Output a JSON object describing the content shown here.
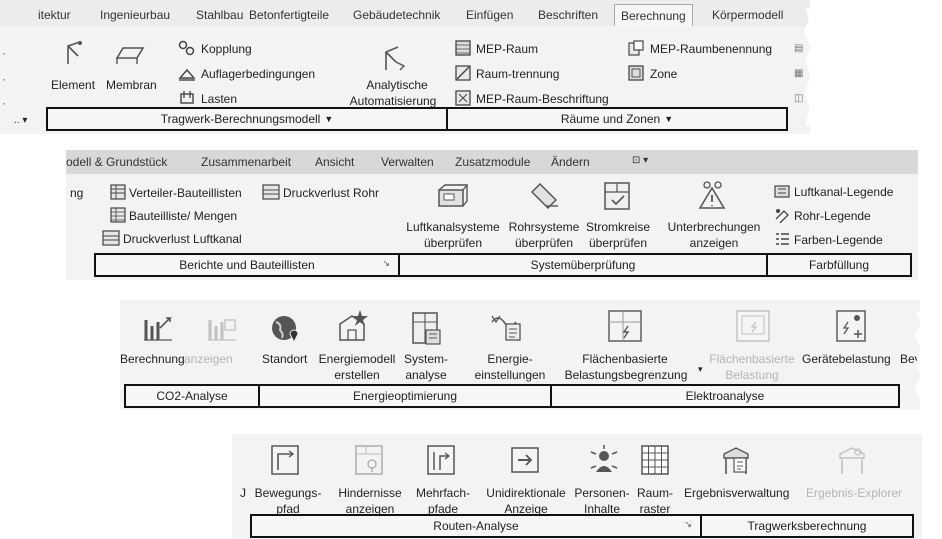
{
  "strip1": {
    "tabs": [
      "itektur",
      "Ingenieurbau",
      "Stahlbau",
      "Betonfertigteile",
      "Gebäudetechnik",
      "Einfügen",
      "Beschriften",
      "Berechnung",
      "Körpermodell"
    ],
    "active_tab": "Berechnung",
    "buttons": {
      "element": "Element",
      "membran": "Membran",
      "kopplung": "Kopplung",
      "auflager": "Auflagerbedingungen",
      "lasten": "Lasten",
      "analytische1": "Analytische",
      "analytische2": "Automatisierung",
      "mep_raum": "MEP-Raum",
      "raum_trennung": "Raum-trennung",
      "mep_raum_beschriftung": "MEP-Raum-Beschriftung",
      "mep_raumbenennung": "MEP-Raumbenennung",
      "zone": "Zone"
    },
    "panels": {
      "tragwerk": "Tragwerk-Berechnungsmodell",
      "raeume": "Räume und Zonen"
    }
  },
  "strip2": {
    "tabs": [
      "odell & Grundstück",
      "Zusammenarbeit",
      "Ansicht",
      "Verwalten",
      "Zusatzmodule",
      "Ändern"
    ],
    "buttons": {
      "ng": "ng",
      "verteiler": "Verteiler-Bauteillisten",
      "druckverlust_rohr": "Druckverlust Rohr",
      "bauteilliste": "Bauteilliste/ Mengen",
      "druckverlust_luftkanal": "Druckverlust Luftkanal",
      "luftkanal1": "Luftkanalsysteme",
      "luftkanal2": "überprüfen",
      "rohr1": "Rohrsysteme",
      "rohr2": "überprüfen",
      "strom1": "Stromkreise",
      "strom2": "überprüfen",
      "unterbr1": "Unterbrechungen",
      "unterbr2": "anzeigen",
      "luftkanal_legende": "Luftkanal-Legende",
      "rohr_legende": "Rohr-Legende",
      "farben_legende": "Farben-Legende"
    },
    "panels": {
      "berichte": "Berichte und Bauteillisten",
      "system": "Systemüberprüfung",
      "farb": "Farbfüllung"
    }
  },
  "strip3": {
    "buttons": {
      "berechnung": "Berechnung",
      "anzeigen": "anzeigen",
      "standort": "Standort",
      "energiemodell1": "Energiemodell",
      "energiemodell2": "erstellen",
      "system1": "System-",
      "system2": "analyse",
      "energie1": "Energie-",
      "energie2": "einstellungen",
      "flaechen1": "Flächenbasierte",
      "flaechen2": "Belastungsbegrenzung",
      "flaechen_grey1": "Flächenbasierte",
      "flaechen_grey2": "Belastung",
      "geraetebelastung": "Gerätebelastung",
      "bev": "Bev"
    },
    "panels": {
      "co2": "CO2-Analyse",
      "energie": "Energieoptimierung",
      "elektro": "Elektroanalyse"
    }
  },
  "strip4": {
    "buttons": {
      "j": "J",
      "bewegung1": "Bewegungs-",
      "bewegung2": "pfad",
      "hindernis1": "Hindernisse",
      "hindernis2": "anzeigen",
      "mehrfach1": "Mehrfach-",
      "mehrfach2": "pfade",
      "unidir1": "Unidirektionale",
      "unidir2": "Anzeige",
      "personen1": "Personen-",
      "personen2": "Inhalte",
      "raum1": "Raum-",
      "raum2": "raster",
      "ergebnisverwaltung": "Ergebnisverwaltung",
      "ergebnis_explorer": "Ergebnis-Explorer"
    },
    "panels": {
      "routen": "Routen-Analyse",
      "tragwerk": "Tragwerksberechnung"
    }
  },
  "colors": {
    "ribbon_bg": "#f3f3f3",
    "tab_bg": "#e4e4e4",
    "frame": "#111111",
    "disabled": "#b5b5b5"
  }
}
